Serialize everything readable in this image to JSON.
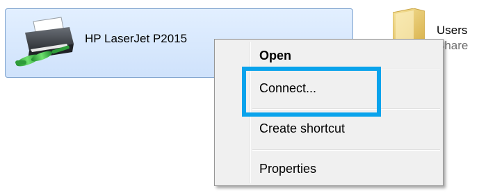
{
  "printer": {
    "name": "HP LaserJet P2015",
    "icon": "network-printer-icon"
  },
  "folder": {
    "name": "Users",
    "sub": "Share",
    "icon": "folder-icon"
  },
  "context_menu": {
    "items": [
      {
        "label": "Open",
        "bold": true
      },
      {
        "label": "Connect..."
      },
      {
        "label": "Create shortcut"
      },
      {
        "label": "Properties"
      }
    ]
  },
  "highlight": {
    "color": "#09a3ec",
    "target": "Connect..."
  }
}
